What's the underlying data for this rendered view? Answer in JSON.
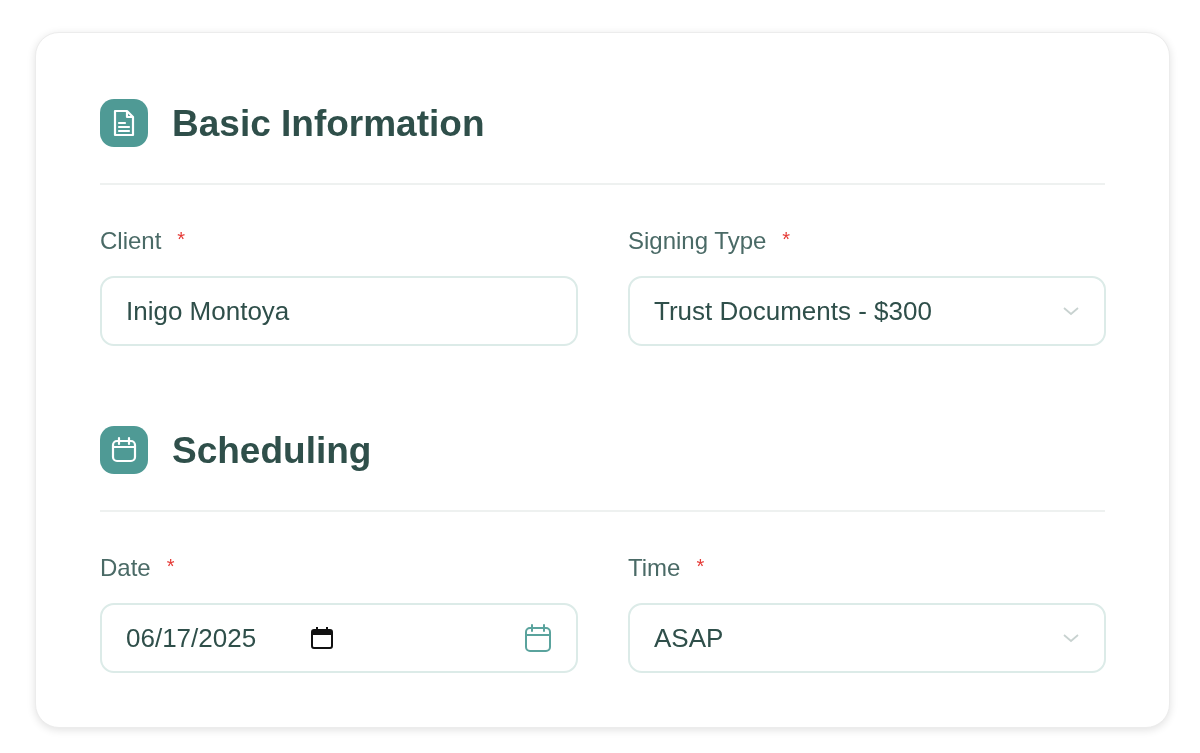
{
  "sections": [
    {
      "title": "Basic Information",
      "fields": [
        {
          "label": "Client",
          "required_mark": "*",
          "kind": "text",
          "value": "Inigo Montoya"
        },
        {
          "label": "Signing Type",
          "required_mark": "*",
          "kind": "select",
          "value": "Trust Documents - $300"
        }
      ]
    },
    {
      "title": "Scheduling",
      "fields": [
        {
          "label": "Date",
          "required_mark": "*",
          "kind": "date",
          "value": "06/17/2025"
        },
        {
          "label": "Time",
          "required_mark": "*",
          "kind": "select",
          "value": "ASAP"
        }
      ]
    }
  ]
}
